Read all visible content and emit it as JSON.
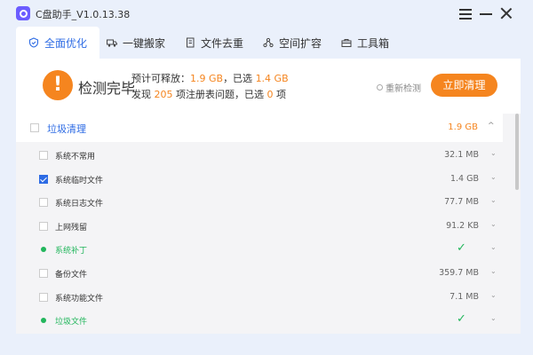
{
  "app": {
    "title": "C盘助手_V1.0.13.38"
  },
  "tabs": [
    {
      "label": "全面优化",
      "icon": "shield-icon",
      "active": true
    },
    {
      "label": "一键搬家",
      "icon": "truck-icon",
      "active": false
    },
    {
      "label": "文件去重",
      "icon": "files-icon",
      "active": false
    },
    {
      "label": "空间扩容",
      "icon": "network-icon",
      "active": false
    },
    {
      "label": "工具箱",
      "icon": "toolbox-icon",
      "active": false
    }
  ],
  "summary": {
    "status": "检测完毕",
    "line1_prefix": "预计可释放：",
    "releasable": "1.9 GB",
    "line1_mid": "，已选",
    "selected_size": "1.4 GB",
    "line2_prefix": "发现",
    "issues": "205",
    "line2_mid": "项注册表问题，已选",
    "selected_issues": "0",
    "line2_suffix": "项",
    "rescan_label": "重新检测",
    "clean_button": "立即清理"
  },
  "section": {
    "label": "垃圾清理",
    "size": "1.9 GB",
    "chevron": "^"
  },
  "rows": [
    {
      "label": "系统不常用",
      "size": "32.1 MB",
      "mode": "checkbox",
      "checked": false
    },
    {
      "label": "系统临时文件",
      "size": "1.4 GB",
      "mode": "checkbox",
      "checked": true
    },
    {
      "label": "系统日志文件",
      "size": "77.7 MB",
      "mode": "checkbox",
      "checked": false
    },
    {
      "label": "上网残留",
      "size": "91.2 KB",
      "mode": "checkbox",
      "checked": false
    },
    {
      "label": "系统补丁",
      "size": "",
      "mode": "dot",
      "checked": false
    },
    {
      "label": "备份文件",
      "size": "359.7 MB",
      "mode": "checkbox",
      "checked": false
    },
    {
      "label": "系统功能文件",
      "size": "7.1 MB",
      "mode": "checkbox",
      "checked": false
    },
    {
      "label": "垃圾文件",
      "size": "",
      "mode": "dot",
      "checked": false
    }
  ],
  "colors": {
    "accent": "#2d6be4",
    "orange": "#f5851f",
    "green": "#22b65c"
  }
}
